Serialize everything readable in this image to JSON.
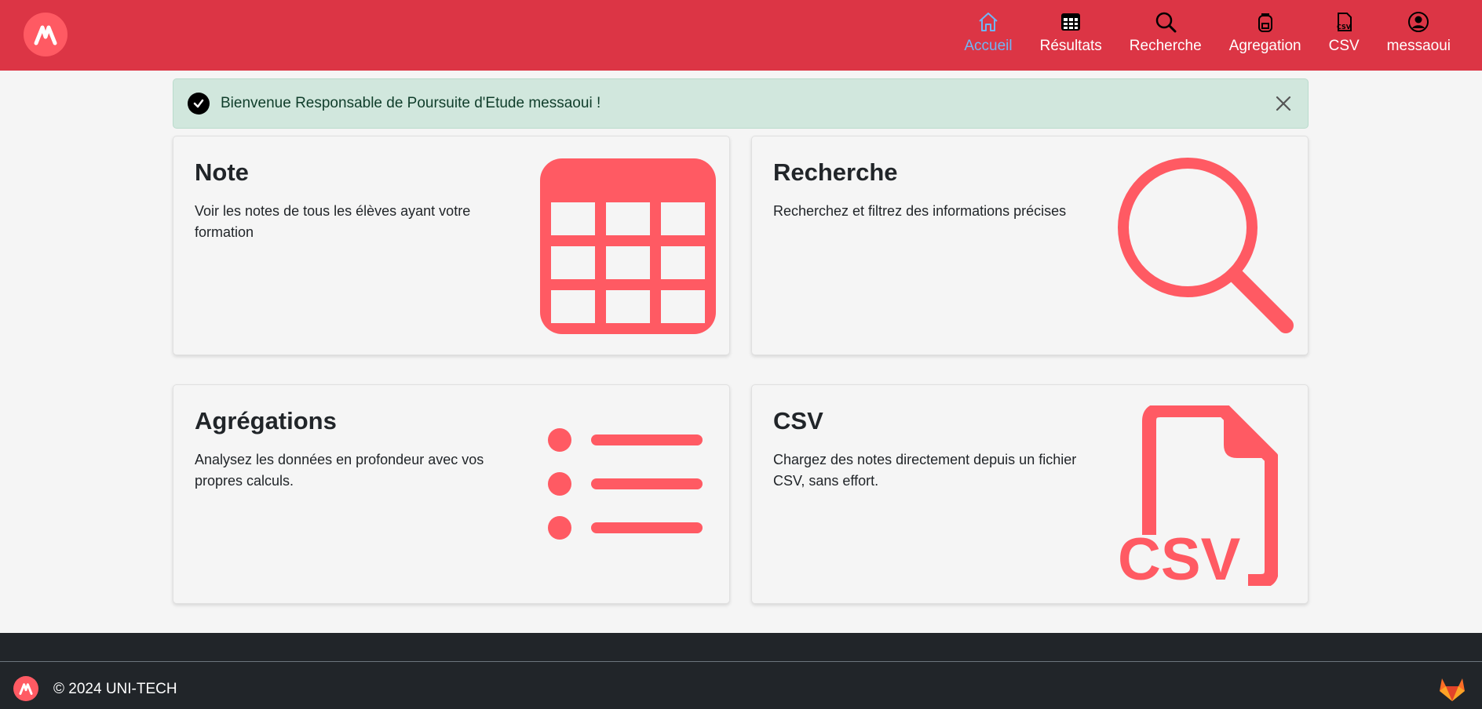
{
  "header": {
    "nav": [
      {
        "label": "Accueil",
        "icon": "home-icon",
        "active": true
      },
      {
        "label": "Résultats",
        "icon": "table-icon",
        "active": false
      },
      {
        "label": "Recherche",
        "icon": "search-icon",
        "active": false
      },
      {
        "label": "Agregation",
        "icon": "backpack-icon",
        "active": false
      },
      {
        "label": "CSV",
        "icon": "csv-file-icon",
        "active": false
      },
      {
        "label": "messaoui",
        "icon": "user-icon",
        "active": false
      }
    ]
  },
  "alert": {
    "message": "Bienvenue Responsable de Poursuite d'Etude messaoui !"
  },
  "cards": [
    {
      "title": "Note",
      "description": "Voir les notes de tous les élèves ayant votre formation",
      "icon": "table-icon"
    },
    {
      "title": "Recherche",
      "description": "Recherchez et filtrez des informations précises",
      "icon": "search-icon"
    },
    {
      "title": "Agrégations",
      "description": "Analysez les données en profondeur avec vos propres calculs.",
      "icon": "list-icon"
    },
    {
      "title": "CSV",
      "description": "Chargez des notes directement depuis un fichier CSV, sans effort.",
      "icon": "csv-file-icon"
    }
  ],
  "footer": {
    "copyright": "© 2024 UNI-TECH",
    "icon": "gitlab-icon"
  },
  "colors": {
    "header": "#dc3545",
    "accent": "#ff5a63",
    "active_nav": "#6fb6f5",
    "alert_bg": "#d1e7dd",
    "footer": "#212529"
  }
}
